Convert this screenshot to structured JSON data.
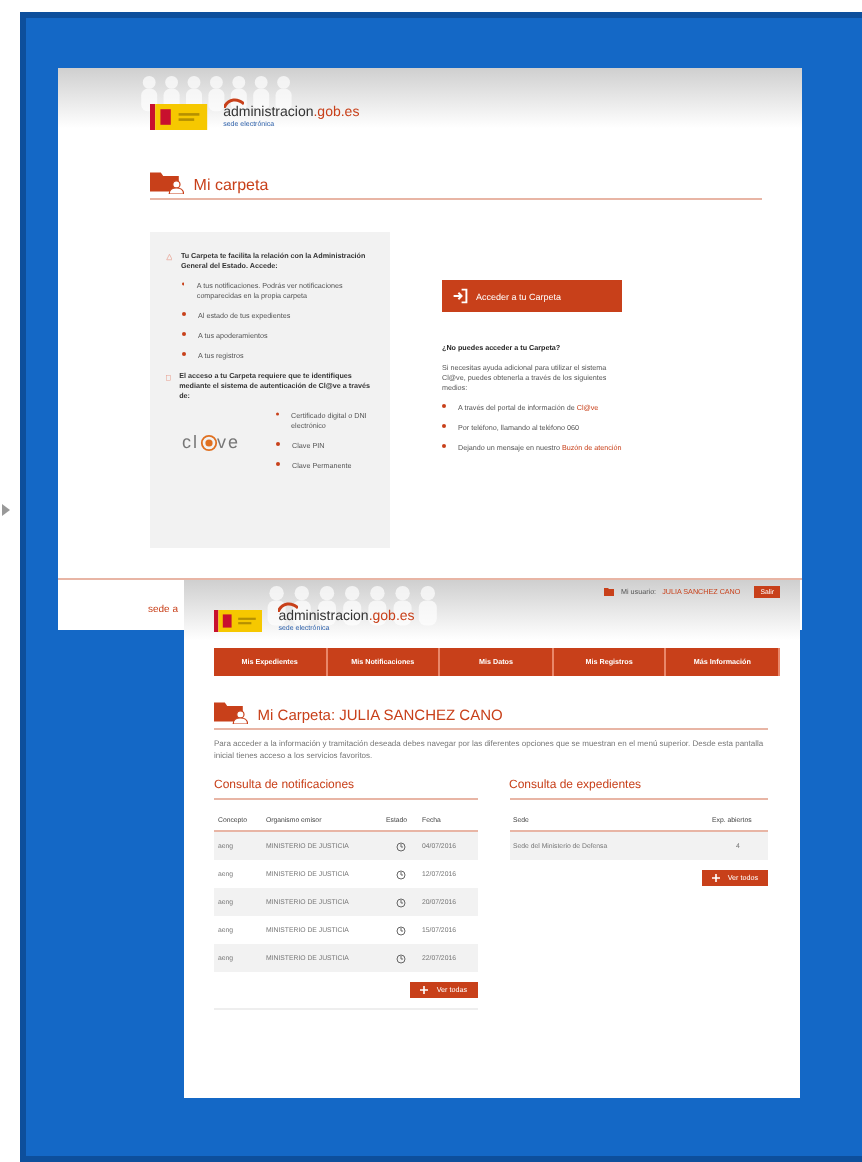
{
  "screenshot_1": {
    "header": {
      "site_name": "administracion",
      "site_domain": ".gob.es",
      "site_subtitle": "sede electrónica"
    },
    "title": "Mi carpeta",
    "info_panel": {
      "intro": "Tu Carpeta te facilita la relación con la Administración General del Estado. Accede:",
      "access_items": [
        "A tus notificaciones. Podrás ver notificaciones comparecidas en la propia carpeta",
        "Al estado de tus expedientes",
        "A tus apoderamientos",
        "A tus registros"
      ],
      "auth_text": "El acceso a tu Carpeta requiere que te identifiques mediante el sistema de autenticación de Cl@ve a través de:",
      "clave_logo": {
        "before": "cl",
        "after": "ve"
      },
      "auth_methods": [
        "Certificado digital o DNI electrónico",
        "Clave PIN",
        "Clave Permanente"
      ]
    },
    "access_button": "Acceder a tu Carpeta",
    "help": {
      "heading": "¿No puedes acceder a tu Carpeta?",
      "text": "Si necesitas ayuda adicional para utilizar el sistema Cl@ve, puedes obtenerla a través de los siguientes medios:",
      "items": [
        {
          "text": "A través del portal de información de ",
          "link": "Cl@ve"
        },
        {
          "text": "Por teléfono, llamando al teléfono 060"
        },
        {
          "text": "Dejando un mensaje en nuestro ",
          "link": "Buzón de atención"
        }
      ]
    },
    "footer_text": "sede a"
  },
  "screenshot_2": {
    "user_label": "Mi usuario:",
    "user_name": "JULIA SANCHEZ CANO",
    "logout_button": "Salir",
    "header": {
      "site_name": "administracion",
      "site_domain": ".gob.es",
      "site_subtitle": "sede electrónica"
    },
    "nav": [
      "Mis Expedientes",
      "Mis Notificaciones",
      "Mis Datos",
      "Mis Registros",
      "Más Información"
    ],
    "title": "Mi Carpeta: JULIA SANCHEZ CANO",
    "intro": "Para acceder a la información y tramitación deseada debes navegar por las diferentes opciones que se muestran en el menú superior. Desde esta pantalla inicial tienes acceso a los servicios favoritos.",
    "notifications": {
      "title": "Consulta de notificaciones",
      "columns": [
        "Concepto",
        "Organismo emisor",
        "Estado",
        "Fecha"
      ],
      "rows": [
        {
          "concept": "aeng",
          "issuer": "MINISTERIO DE JUSTICIA",
          "date": "04/07/2016"
        },
        {
          "concept": "aeng",
          "issuer": "MINISTERIO DE JUSTICIA",
          "date": "12/07/2016"
        },
        {
          "concept": "aeng",
          "issuer": "MINISTERIO DE JUSTICIA",
          "date": "20/07/2016"
        },
        {
          "concept": "aeng",
          "issuer": "MINISTERIO DE JUSTICIA",
          "date": "15/07/2016"
        },
        {
          "concept": "aeng",
          "issuer": "MINISTERIO DE JUSTICIA",
          "date": "22/07/2016"
        }
      ],
      "button": "Ver todas"
    },
    "records": {
      "title": "Consulta de expedientes",
      "columns": [
        "Sede",
        "Exp. abiertos"
      ],
      "rows": [
        {
          "site": "Sede del Ministerio de Defensa",
          "open": "4"
        }
      ],
      "button": "Ver todos"
    }
  }
}
